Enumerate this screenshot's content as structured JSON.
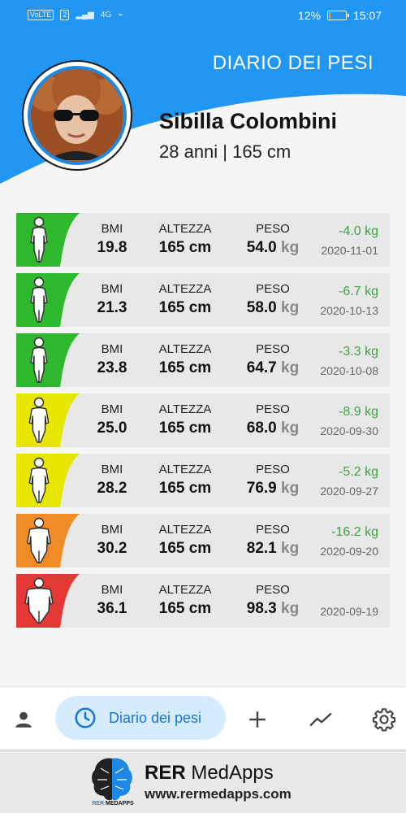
{
  "status_bar": {
    "network_chips": [
      "VoLTE",
      "2"
    ],
    "signal_label": "4G",
    "battery_percent": "12%",
    "battery_level": 0.12,
    "time": "15:07"
  },
  "header": {
    "title": "DIARIO DEI PESI",
    "user_name": "Sibilla Colombini",
    "user_info": "28 anni | 165 cm"
  },
  "colors": {
    "primary": "#2196f3",
    "green": "#2eb82e",
    "yellow": "#e6e600",
    "orange": "#f08c28",
    "red": "#e53935",
    "delta_green": "#43a047"
  },
  "labels": {
    "bmi": "BMI",
    "altezza": "ALTEZZA",
    "peso": "PESO",
    "weight_unit": "kg"
  },
  "entries": [
    {
      "bmi": "19.8",
      "altezza": "165 cm",
      "peso": "54.0",
      "delta": "-4.0 kg",
      "date": "2020-11-01",
      "status": "green",
      "figure": "slim"
    },
    {
      "bmi": "21.3",
      "altezza": "165 cm",
      "peso": "58.0",
      "delta": "-6.7 kg",
      "date": "2020-10-13",
      "status": "green",
      "figure": "slim"
    },
    {
      "bmi": "23.8",
      "altezza": "165 cm",
      "peso": "64.7",
      "delta": "-3.3 kg",
      "date": "2020-10-08",
      "status": "green",
      "figure": "slim"
    },
    {
      "bmi": "25.0",
      "altezza": "165 cm",
      "peso": "68.0",
      "delta": "-8.9 kg",
      "date": "2020-09-30",
      "status": "yellow",
      "figure": "medium"
    },
    {
      "bmi": "28.2",
      "altezza": "165 cm",
      "peso": "76.9",
      "delta": "-5.2 kg",
      "date": "2020-09-27",
      "status": "yellow",
      "figure": "medium"
    },
    {
      "bmi": "30.2",
      "altezza": "165 cm",
      "peso": "82.1",
      "delta": "-16.2 kg",
      "date": "2020-09-20",
      "status": "orange",
      "figure": "large"
    },
    {
      "bmi": "36.1",
      "altezza": "165 cm",
      "peso": "98.3",
      "delta": "",
      "date": "2020-09-19",
      "status": "red",
      "figure": "xlarge"
    }
  ],
  "bottom_nav": {
    "items": [
      {
        "icon": "person-icon"
      },
      {
        "icon": "clock-icon",
        "label": "Diario dei pesi",
        "active": true
      },
      {
        "icon": "plus-icon"
      },
      {
        "icon": "trend-icon"
      },
      {
        "icon": "gear-icon"
      }
    ]
  },
  "ad": {
    "title_bold": "RER",
    "title_light": " MedApps",
    "url": "www.rermedapps.com",
    "logo_text_r": "RER",
    "logo_text": " MEDAPPS"
  }
}
